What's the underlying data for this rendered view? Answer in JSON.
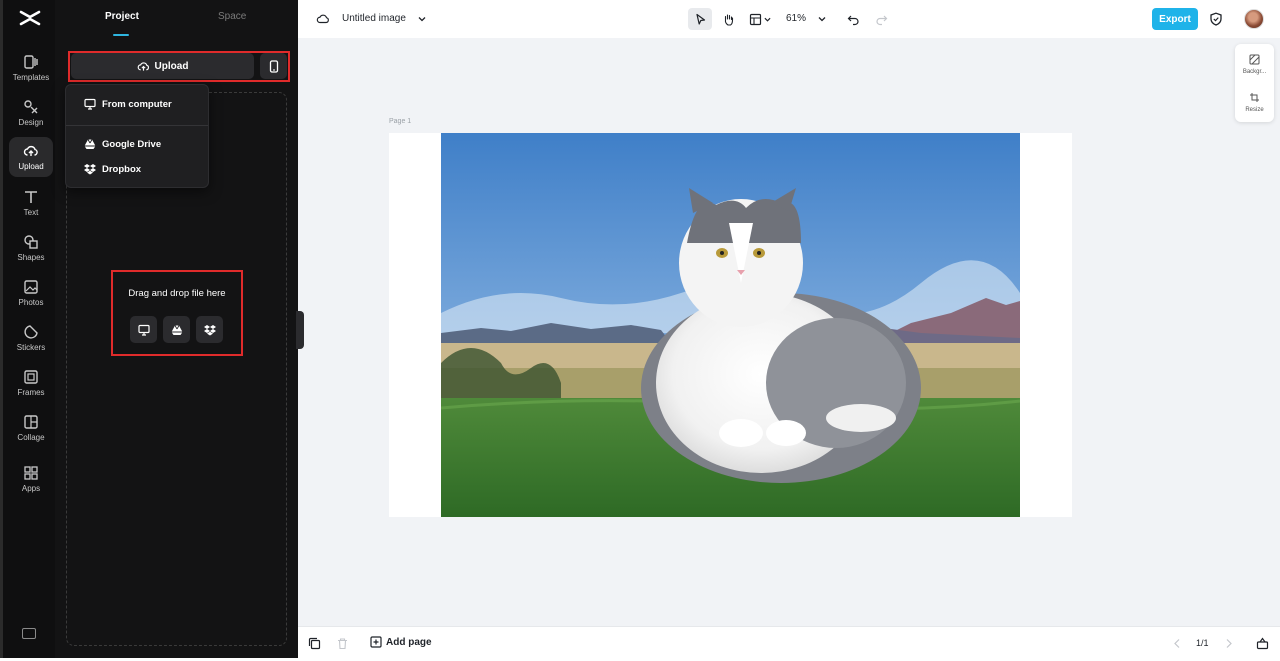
{
  "rail": {
    "items": [
      {
        "label": "Templates"
      },
      {
        "label": "Design"
      },
      {
        "label": "Upload"
      },
      {
        "label": "Text"
      },
      {
        "label": "Shapes"
      },
      {
        "label": "Photos"
      },
      {
        "label": "Stickers"
      },
      {
        "label": "Frames"
      },
      {
        "label": "Collage"
      },
      {
        "label": "Apps"
      }
    ],
    "active": "Upload"
  },
  "panel": {
    "tabs": {
      "project": "Project",
      "space": "Space"
    },
    "upload_label": "Upload",
    "menu": {
      "from_computer": "From computer",
      "google_drive": "Google Drive",
      "dropbox": "Dropbox"
    },
    "drop_text": "Drag and drop file here"
  },
  "topbar": {
    "title": "Untitled image",
    "zoom": "61%",
    "export_label": "Export"
  },
  "rightfloat": {
    "background": "Backgr...",
    "resize": "Resize"
  },
  "canvas": {
    "page_label": "Page 1"
  },
  "bottombar": {
    "add_page": "Add page",
    "page_indicator": "1/1"
  },
  "colors": {
    "accent": "#1fb3e9",
    "highlight_box": "#e02b2b",
    "panel_bg": "#131314"
  }
}
